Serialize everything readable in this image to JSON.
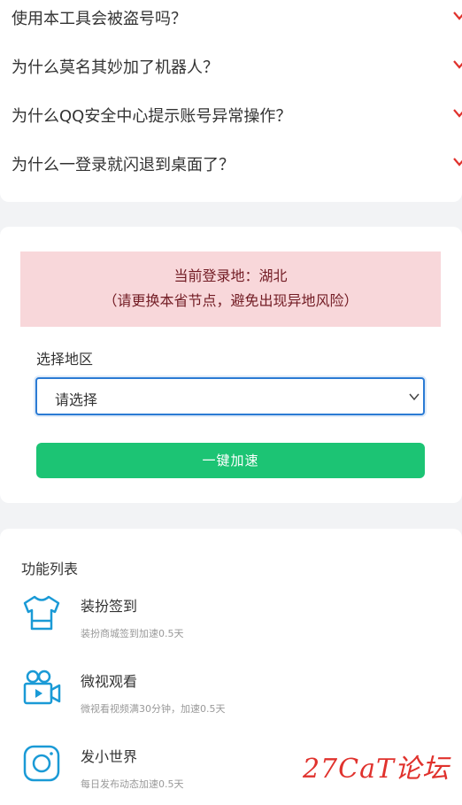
{
  "faq": {
    "items": [
      "使用本工具会被盗号吗？",
      "为什么莫名其妙加了机器人？",
      "为什么QQ安全中心提示账号异常操作？",
      "为什么一登录就闪退到桌面了？"
    ]
  },
  "region": {
    "alert_line1": "当前登录地：湖北",
    "alert_line2": "（请更换本省节点，避免出现异地风险）",
    "label": "选择地区",
    "select_value": "请选择",
    "button_label": "一键加速"
  },
  "features": {
    "title": "功能列表",
    "items": [
      {
        "name": "装扮签到",
        "desc": "装扮商城签到加速0.5天",
        "icon": "shirt-icon"
      },
      {
        "name": "微视观看",
        "desc": "微视看视频满30分钟，加速0.5天",
        "icon": "video-camera-icon"
      },
      {
        "name": "发小世界",
        "desc": "每日发布动态加速0.5天",
        "icon": "camera-icon"
      }
    ]
  },
  "watermark": "27CaT论坛",
  "colors": {
    "accent_blue": "#1a9ad6",
    "button_green": "#1cc474",
    "alert_bg": "#f8d7da",
    "alert_text": "#721c24",
    "chevron_red": "#e0322d"
  }
}
